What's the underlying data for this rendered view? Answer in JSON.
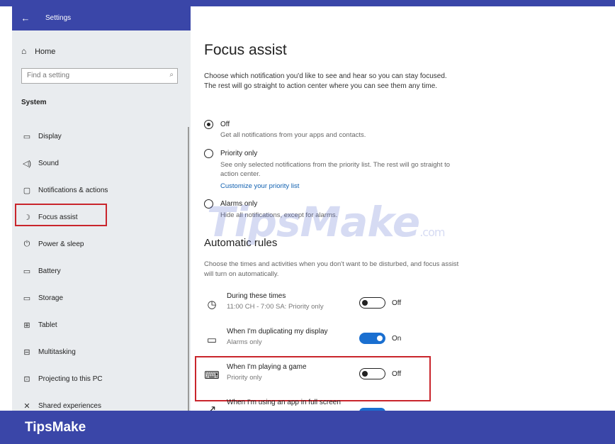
{
  "window": {
    "back_icon": "←",
    "title": "Settings"
  },
  "sidebar": {
    "home_icon": "⌂",
    "home_label": "Home",
    "search_placeholder": "Find a setting",
    "search_icon": "⌕",
    "section_label": "System",
    "items": [
      {
        "icon": "▭",
        "label": "Display"
      },
      {
        "icon": "◁)",
        "label": "Sound"
      },
      {
        "icon": "▢",
        "label": "Notifications & actions"
      },
      {
        "icon": "☽",
        "label": "Focus assist"
      },
      {
        "icon": "⏻",
        "label": "Power & sleep"
      },
      {
        "icon": "▭",
        "label": "Battery"
      },
      {
        "icon": "▭",
        "label": "Storage"
      },
      {
        "icon": "⊞",
        "label": "Tablet"
      },
      {
        "icon": "⊟",
        "label": "Multitasking"
      },
      {
        "icon": "⊡",
        "label": "Projecting to this PC"
      },
      {
        "icon": "✕",
        "label": "Shared experiences"
      }
    ],
    "selected_item": "Focus assist"
  },
  "main": {
    "title": "Focus assist",
    "description": "Choose which notification you'd like to see and hear so you can stay focused. The rest will go straight to action center where you can see them any time.",
    "options": [
      {
        "label": "Off",
        "sub": "Get all notifications from your apps and contacts.",
        "selected": true
      },
      {
        "label": "Priority only",
        "sub": "See only selected notifications from the priority list. The rest will go straight to action center.",
        "link": "Customize your priority list",
        "selected": false
      },
      {
        "label": "Alarms only",
        "sub": "Hide all notifications, except for alarms.",
        "selected": false
      }
    ],
    "rules_title": "Automatic rules",
    "rules_description": "Choose the times and activities when you don't want to be disturbed, and focus assist will turn on automatically.",
    "rules": [
      {
        "icon": "clock-icon",
        "glyph": "◷",
        "title": "During these times",
        "sub": "11:00 CH - 7:00 SA: Priority only",
        "state": "Off"
      },
      {
        "icon": "monitor-icon",
        "glyph": "▭",
        "title": "When I'm duplicating my display",
        "sub": "Alarms only",
        "state": "On"
      },
      {
        "icon": "gamepad-icon",
        "glyph": "⌨",
        "title": "When I'm playing a game",
        "sub": "Priority only",
        "state": "Off"
      },
      {
        "icon": "fullscreen-icon",
        "glyph": "↗",
        "title": "When I'm using an app in full screen",
        "sub": "",
        "state": "On"
      }
    ]
  },
  "watermark": {
    "text": "TipsMake",
    "suffix": ".com"
  },
  "footer": {
    "brand": "TipsMake"
  },
  "colors": {
    "accent": "#3a46a8",
    "toggle_on": "#1a6fd0",
    "highlight": "#c9252c"
  }
}
